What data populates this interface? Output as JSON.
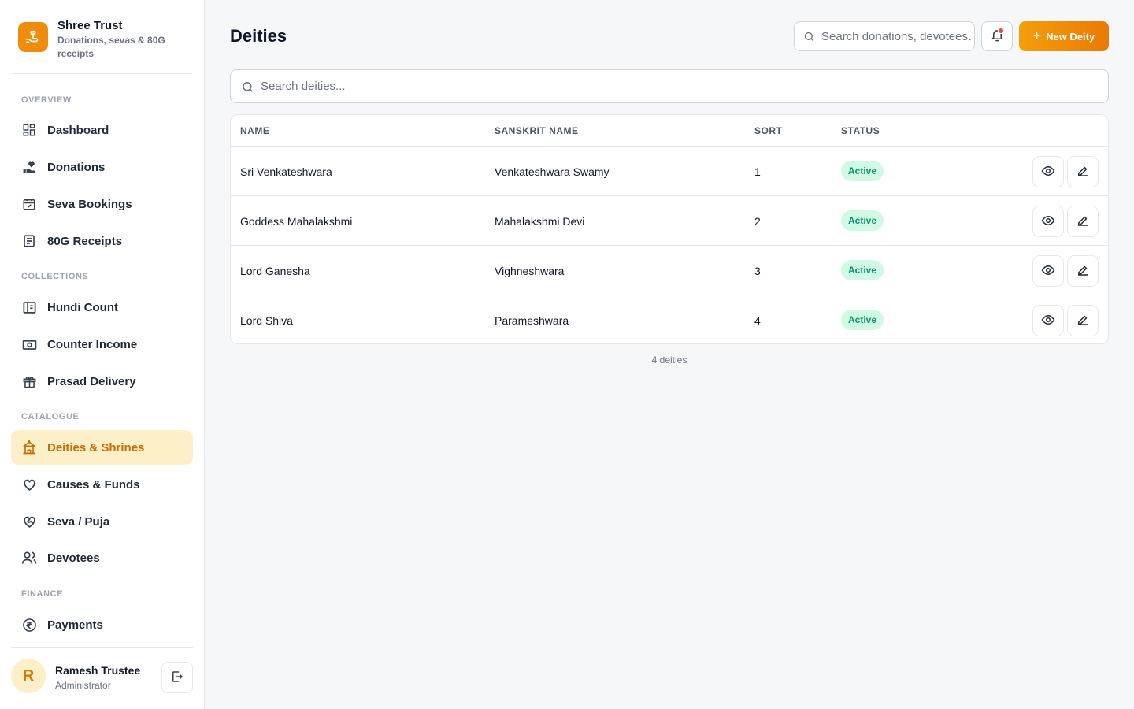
{
  "brand": {
    "name": "Shree Trust",
    "subtitle": "Donations, sevas & 80G receipts"
  },
  "sidebar": {
    "sections": [
      {
        "label": "OVERVIEW"
      },
      {
        "label": "COLLECTIONS"
      },
      {
        "label": "CATALOGUE"
      },
      {
        "label": "FINANCE"
      }
    ],
    "items": [
      {
        "label": "Dashboard",
        "icon": "dashboard-icon"
      },
      {
        "label": "Donations",
        "icon": "hand-heart-icon"
      },
      {
        "label": "Seva Bookings",
        "icon": "calendar-check-icon"
      },
      {
        "label": "80G Receipts",
        "icon": "receipt-icon"
      },
      {
        "label": "Hundi Count",
        "icon": "hundi-icon"
      },
      {
        "label": "Counter Income",
        "icon": "cash-icon"
      },
      {
        "label": "Prasad Delivery",
        "icon": "gift-icon"
      },
      {
        "label": "Deities & Shrines",
        "icon": "temple-icon",
        "active": true
      },
      {
        "label": "Causes & Funds",
        "icon": "heart-icon"
      },
      {
        "label": "Seva / Puja",
        "icon": "heart-handshake-icon"
      },
      {
        "label": "Devotees",
        "icon": "users-icon"
      },
      {
        "label": "Payments",
        "icon": "rupee-icon"
      }
    ]
  },
  "user": {
    "initial": "R",
    "name": "Ramesh Trustee",
    "role": "Administrator"
  },
  "header": {
    "title": "Deities",
    "search_placeholder": "Search donations, devotees…",
    "new_button_label": "New Deity"
  },
  "deity_search": {
    "placeholder": "Search deities..."
  },
  "table": {
    "columns": [
      "NAME",
      "SANSKRIT NAME",
      "SORT",
      "STATUS"
    ],
    "rows": [
      {
        "name": "Sri Venkateshwara",
        "sanskrit": "Venkateshwara Swamy",
        "sort": "1",
        "status": "Active"
      },
      {
        "name": "Goddess Mahalakshmi",
        "sanskrit": "Mahalakshmi Devi",
        "sort": "2",
        "status": "Active"
      },
      {
        "name": "Lord Ganesha",
        "sanskrit": "Vighneshwara",
        "sort": "3",
        "status": "Active"
      },
      {
        "name": "Lord Shiva",
        "sanskrit": "Parameshwara",
        "sort": "4",
        "status": "Active"
      }
    ],
    "footer": "4 deities"
  },
  "colors": {
    "accent": "#f08c0b",
    "active_bg": "#fdefc7",
    "active_text": "#c96d05",
    "badge_bg": "#d1fae5",
    "badge_text": "#059669"
  }
}
